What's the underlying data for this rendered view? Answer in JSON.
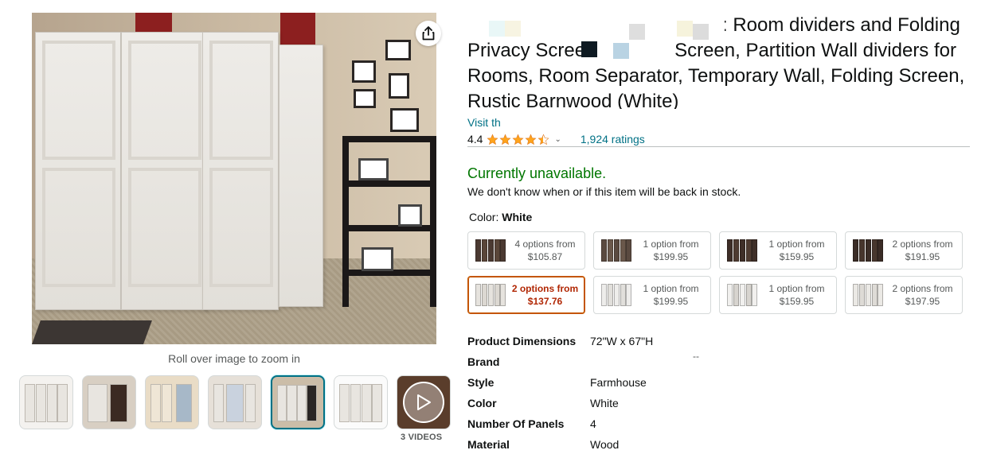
{
  "title": {
    "text": ": Room dividers and Folding Privacy Screen, Privacy Screen, Partition Wall dividers for Rooms, Room Separator, Temporary Wall, Folding Screen, Rustic Barnwood (White)"
  },
  "store_link": "Visit th",
  "rating": {
    "value": "4.4",
    "stars": 4.4,
    "count_label": "1,924 ratings"
  },
  "availability": {
    "status": "Currently unavailable.",
    "note": "We don't know when or if this item will be back in stock."
  },
  "color": {
    "label": "Color: ",
    "selected": "White"
  },
  "swatches": [
    {
      "line1": "4 options from",
      "line2": "$105.87",
      "tone": "dark"
    },
    {
      "line1": "1 option from",
      "line2": "$199.95",
      "tone": "dark"
    },
    {
      "line1": "1 option from",
      "line2": "$159.95",
      "tone": "dark"
    },
    {
      "line1": "2 options from",
      "line2": "$191.95",
      "tone": "dark"
    },
    {
      "line1": "2 options from",
      "line2": "$137.76",
      "tone": "light"
    },
    {
      "line1": "1 option from",
      "line2": "$199.95",
      "tone": "light"
    },
    {
      "line1": "1 option from",
      "line2": "$159.95",
      "tone": "light"
    },
    {
      "line1": "2 options from",
      "line2": "$197.95",
      "tone": "light"
    }
  ],
  "specs": [
    {
      "key": "Product Dimensions",
      "value": "72\"W x 67\"H"
    },
    {
      "key": "Brand",
      "value": ""
    },
    {
      "key": "Style",
      "value": "Farmhouse"
    },
    {
      "key": "Color",
      "value": "White"
    },
    {
      "key": "Number Of Panels",
      "value": "4"
    },
    {
      "key": "Material",
      "value": "Wood"
    }
  ],
  "brand_placeholder": "--",
  "image": {
    "zoom_hint": "Roll over image to zoom in",
    "video_count": "3 VIDEOS",
    "share_icon": "share-icon",
    "play_icon": "play-icon"
  },
  "colors": {
    "link": "#007185",
    "available_green": "#007600",
    "selected_border": "#c45500",
    "selected_price": "#b12704",
    "star": "#ffa41c",
    "thumb_selected": "#007185"
  }
}
